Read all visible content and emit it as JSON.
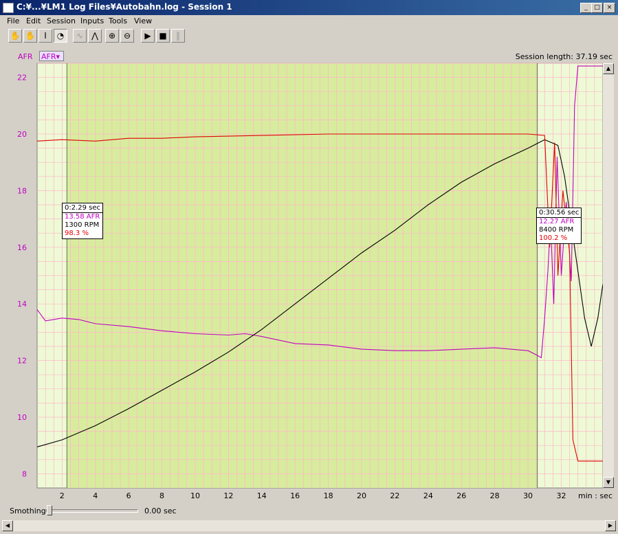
{
  "window": {
    "title": "C:¥...¥LM1 Log Files¥Autobahn.log - Session 1",
    "minimize_glyph": "_",
    "maximize_glyph": "□",
    "close_glyph": "×"
  },
  "menu": [
    "File",
    "Edit",
    "Session",
    "Inputs",
    "Tools",
    "View"
  ],
  "toolbar": {
    "buttons": [
      "hand-icon",
      "hand-disabled-icon",
      "text-cursor-icon",
      "stopwatch-icon",
      "wave-smooth-icon",
      "wave-sharp-icon",
      "zoom-in-icon",
      "zoom-out-icon",
      "play-icon",
      "stop-icon",
      "pause-icon"
    ],
    "glyphs": [
      "✋",
      "✋",
      "I",
      "◔",
      "∿",
      "⋀",
      "⊕",
      "⊖",
      "▶",
      "■",
      "‖"
    ]
  },
  "header": {
    "afr_label": "AFR",
    "afr_dropdown": "AFR▾",
    "session_length": "Session length:  37.19 sec"
  },
  "colors": {
    "afr": "#c000c0",
    "rpm": "#000000",
    "percent": "#e00000",
    "plot_bg": "#eefad6",
    "selection_bg": "#d8ec9e",
    "grid": "#ffb4c8"
  },
  "chart_data": {
    "type": "line",
    "xlim": [
      0.5,
      34.5
    ],
    "ylim": [
      7.5,
      22.5
    ],
    "x_unit_label": "min : sec",
    "x_ticks": [
      "2",
      "4",
      "6",
      "8",
      "10",
      "12",
      "14",
      "16",
      "18",
      "20",
      "22",
      "24",
      "26",
      "28",
      "30",
      "32"
    ],
    "y_ticks": [
      "8",
      "10",
      "12",
      "14",
      "16",
      "18",
      "20",
      "22"
    ],
    "selection": [
      2.29,
      30.56
    ],
    "series": [
      {
        "name": "AFR",
        "color": "#c000c0",
        "points": [
          [
            0.5,
            13.8
          ],
          [
            1.0,
            13.4
          ],
          [
            2.0,
            13.5
          ],
          [
            3.0,
            13.45
          ],
          [
            4.0,
            13.3
          ],
          [
            6.0,
            13.2
          ],
          [
            8.0,
            13.05
          ],
          [
            10.0,
            12.95
          ],
          [
            12.0,
            12.9
          ],
          [
            13.0,
            12.95
          ],
          [
            14.0,
            12.85
          ],
          [
            16.0,
            12.6
          ],
          [
            18.0,
            12.55
          ],
          [
            20.0,
            12.4
          ],
          [
            22.0,
            12.35
          ],
          [
            24.0,
            12.35
          ],
          [
            26.0,
            12.4
          ],
          [
            28.0,
            12.45
          ],
          [
            30.0,
            12.35
          ],
          [
            30.5,
            12.2
          ],
          [
            30.8,
            12.1
          ],
          [
            31.0,
            13.5
          ],
          [
            31.2,
            15.2
          ],
          [
            31.35,
            16.9
          ],
          [
            31.55,
            14.0
          ],
          [
            31.75,
            19.2
          ],
          [
            32.0,
            15.0
          ],
          [
            32.3,
            17.6
          ],
          [
            32.6,
            14.8
          ],
          [
            32.8,
            21.0
          ],
          [
            33.0,
            22.4
          ],
          [
            34.5,
            22.4
          ]
        ]
      },
      {
        "name": "RPM",
        "color": "#000000",
        "points": [
          [
            0.5,
            8.95
          ],
          [
            2.0,
            9.2
          ],
          [
            4.0,
            9.7
          ],
          [
            6.0,
            10.3
          ],
          [
            8.0,
            10.95
          ],
          [
            10.0,
            11.6
          ],
          [
            12.0,
            12.3
          ],
          [
            14.0,
            13.1
          ],
          [
            16.0,
            14.0
          ],
          [
            18.0,
            14.9
          ],
          [
            20.0,
            15.8
          ],
          [
            22.0,
            16.6
          ],
          [
            24.0,
            17.5
          ],
          [
            26.0,
            18.3
          ],
          [
            28.0,
            18.95
          ],
          [
            30.0,
            19.5
          ],
          [
            31.0,
            19.8
          ],
          [
            31.8,
            19.6
          ],
          [
            32.2,
            18.5
          ],
          [
            32.8,
            16.0
          ],
          [
            33.4,
            13.5
          ],
          [
            33.8,
            12.5
          ],
          [
            34.2,
            13.5
          ],
          [
            34.5,
            14.7
          ]
        ]
      },
      {
        "name": "%",
        "color": "#e00000",
        "points": [
          [
            0.5,
            19.75
          ],
          [
            2.0,
            19.8
          ],
          [
            4.0,
            19.75
          ],
          [
            6.0,
            19.85
          ],
          [
            8.0,
            19.85
          ],
          [
            10.0,
            19.9
          ],
          [
            14.0,
            19.95
          ],
          [
            18.0,
            20.0
          ],
          [
            22.0,
            20.0
          ],
          [
            26.0,
            20.0
          ],
          [
            30.0,
            20.0
          ],
          [
            31.0,
            19.95
          ],
          [
            31.3,
            16.0
          ],
          [
            31.6,
            19.7
          ],
          [
            31.8,
            15.0
          ],
          [
            32.1,
            18.0
          ],
          [
            32.5,
            15.8
          ],
          [
            32.7,
            9.2
          ],
          [
            33.0,
            8.45
          ],
          [
            34.5,
            8.45
          ]
        ]
      }
    ]
  },
  "tooltips": {
    "left": {
      "time": "0:2.29 sec",
      "afr": "13.58 AFR",
      "rpm": "1300 RPM",
      "pct": "98.3 %"
    },
    "right": {
      "time": "0:30.56 sec",
      "afr": "12.27 AFR",
      "rpm": "8400 RPM",
      "pct": "100.2 %"
    }
  },
  "smoothing": {
    "label": "Smothing:",
    "value": "0.00 sec"
  },
  "scroll": {
    "up": "▲",
    "down": "▼",
    "left": "◀",
    "right": "▶"
  }
}
